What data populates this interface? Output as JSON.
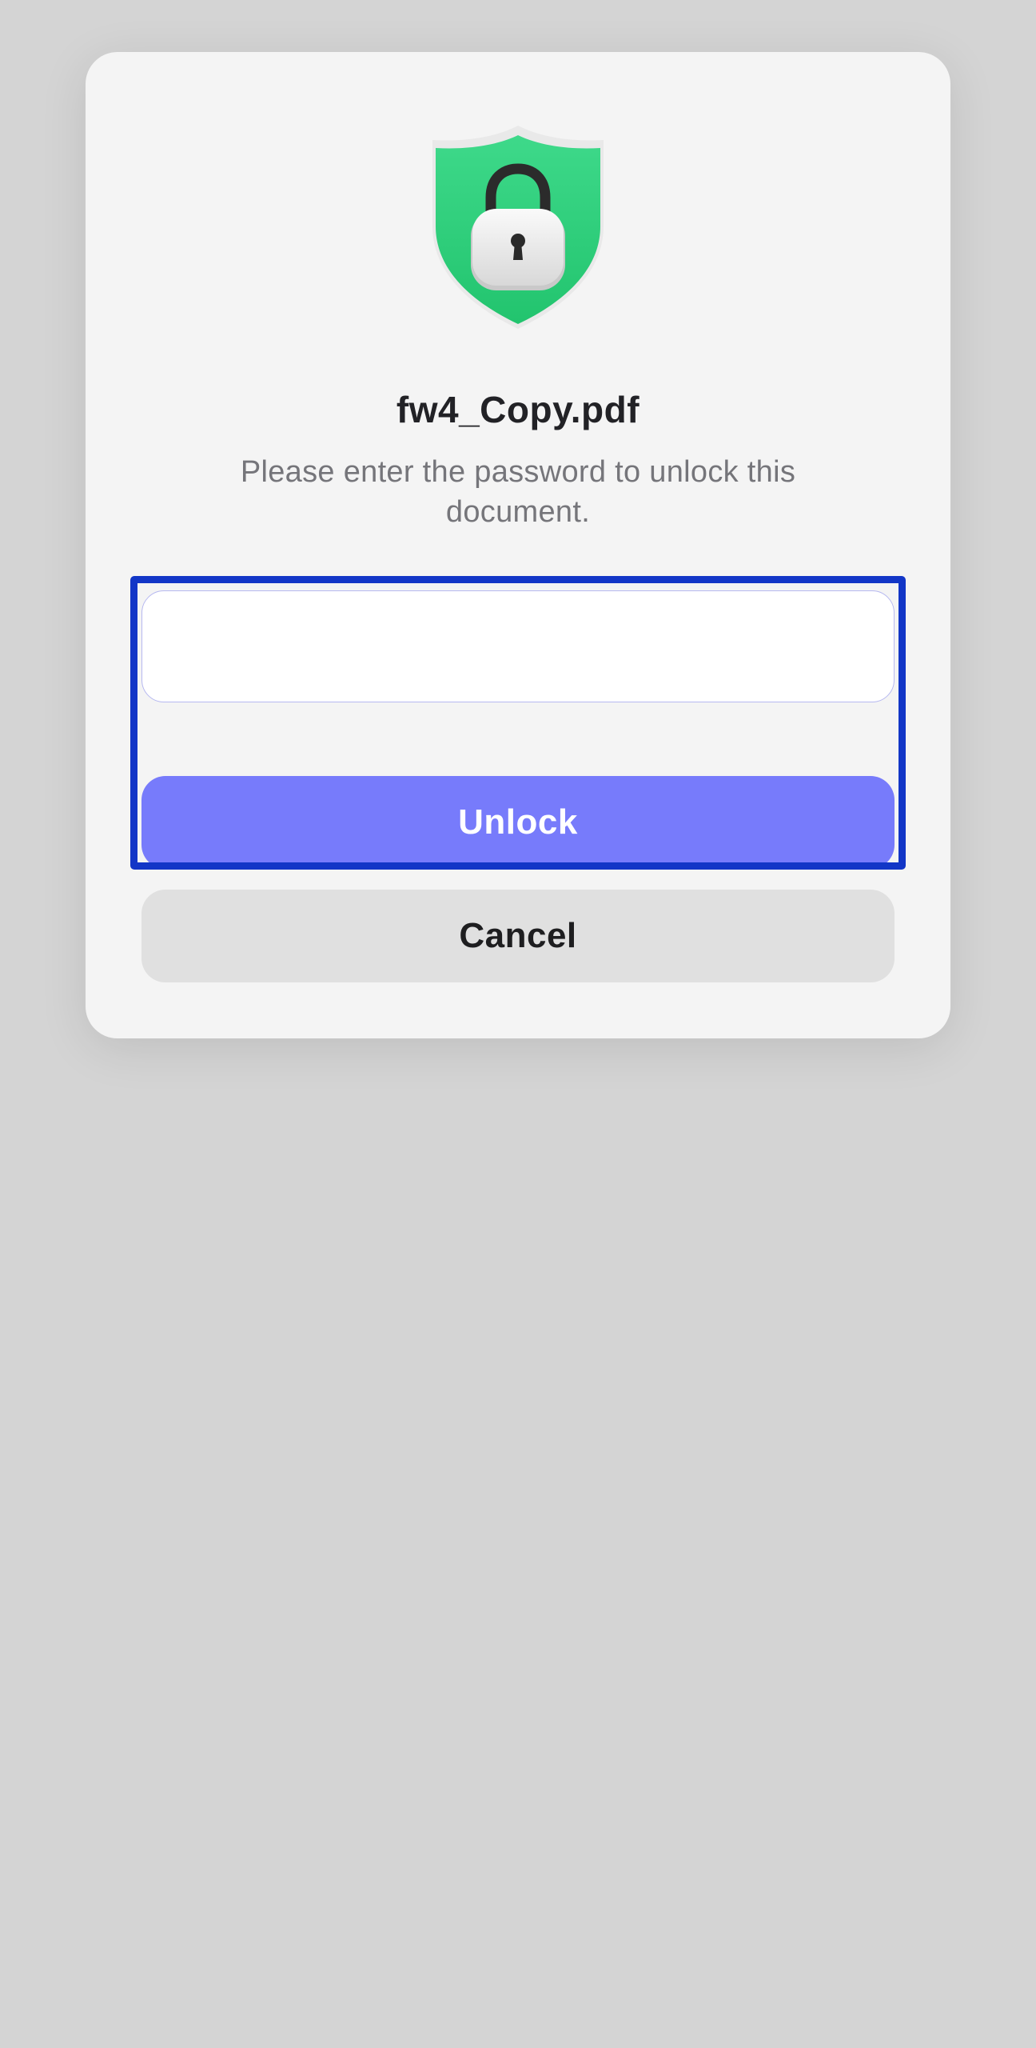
{
  "dialog": {
    "icon": "shield-lock-icon",
    "title": "fw4_Copy.pdf",
    "message": "Please enter the password to unlock this document.",
    "password_value": "",
    "password_placeholder": "",
    "unlock_label": "Unlock",
    "cancel_label": "Cancel"
  },
  "colors": {
    "background": "#d4d4d4",
    "dialog": "#f4f4f4",
    "shield": "#2fd17d",
    "accent": "#777bfb",
    "cancel_bg": "#e0e0e0",
    "highlight": "#1236c7"
  }
}
